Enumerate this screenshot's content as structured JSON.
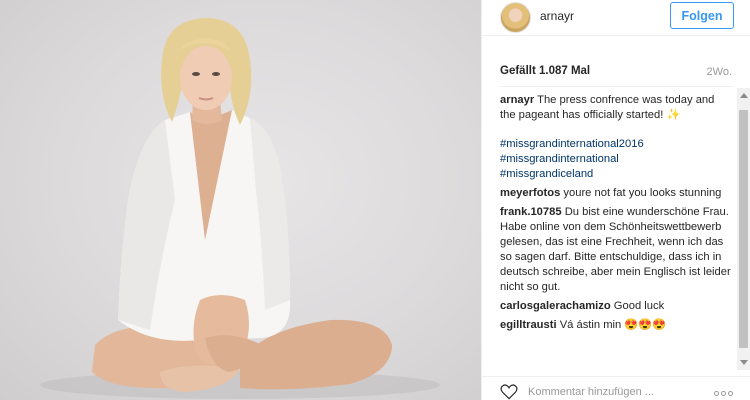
{
  "post": {
    "username": "arnayr",
    "follow_label": "Folgen",
    "likes": "Gefällt 1.087 Mal",
    "time": "2Wo."
  },
  "caption": {
    "user": "arnayr",
    "text": "The press confrence was today and the pageant has officially started! ✨",
    "hashtags": [
      "#missgrandinternational2016",
      "#missgrandinternational",
      "#missgrandiceland"
    ]
  },
  "comments": [
    {
      "user": "meyerfotos",
      "text": "youre not fat you looks stunning"
    },
    {
      "user": "frank.10785",
      "text": "Du bist eine wunderschöne Frau. Habe online von dem Schönheitswettbewerb gelesen, das ist eine Frechheit, wenn ich das so sagen darf. Bitte entschuldige, dass ich in deutsch schreibe, aber mein Englisch ist leider nicht so gut."
    },
    {
      "user": "carlosgalerachamizo",
      "text": "Good luck"
    },
    {
      "user": "egilltrausti",
      "text": "Vá ástin min 😍😍😍"
    }
  ],
  "footer": {
    "comment_placeholder": "Kommentar hinzufügen ..."
  },
  "icons": {
    "like": "heart-icon",
    "options": "more-options-icon"
  },
  "colors": {
    "accent": "#3897f0",
    "hashtag": "#003569",
    "muted": "#999999"
  }
}
